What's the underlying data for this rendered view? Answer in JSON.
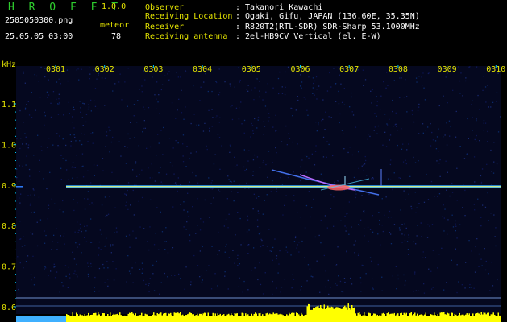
{
  "header": {
    "app_title": "H R O F F T",
    "app_version": "1.0.0",
    "file_name": "2505050300.png",
    "date_time": "25.05.05 03:00",
    "meteor_label": "meteor",
    "meteor_count": "78"
  },
  "info": [
    {
      "label": "Observer",
      "value": ": Takanori Kawachi"
    },
    {
      "label": "Receiving Location",
      "value": ": Ogaki, Gifu, JAPAN (136.60E, 35.35N)"
    },
    {
      "label": "Receiver",
      "value": ": R820T2(RTL-SDR) SDR-Sharp 53.1000MHz"
    },
    {
      "label": "Receiving antenna",
      "value": ": 2el-HB9CV Vertical (el. E-W)"
    }
  ],
  "axes": {
    "y_unit": "kHz",
    "x_ticks": [
      "0301",
      "0302",
      "0303",
      "0304",
      "0305",
      "0306",
      "0307",
      "0308",
      "0309",
      "0310"
    ],
    "y_ticks": [
      "1.1",
      "1.0",
      "0.9",
      "0.8",
      "0.7",
      "0.6"
    ]
  },
  "colors": {
    "background": "#000000",
    "plot_background": "#05081f",
    "axis_text": "#e6e600",
    "tick_marks": "#00c8ff",
    "carrier_line": "#ffff66",
    "meteor_trace": "#ff6666",
    "level_bars": "#ffff00"
  }
}
